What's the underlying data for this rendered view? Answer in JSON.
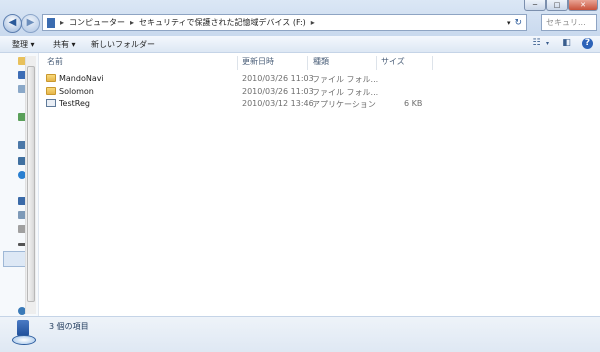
{
  "window": {
    "controls": {
      "minimize": "─",
      "maximize": "□",
      "close": "✕"
    }
  },
  "address": {
    "segments": [
      "コンピューター",
      "セキュリティで保護された記憶域デバイス (F:)"
    ],
    "separator": "▸"
  },
  "search": {
    "placeholder": "セキュリ..."
  },
  "toolbar": {
    "organize": "整理 ▾",
    "share": "共有 ▾",
    "new_folder": "新しいフォルダー"
  },
  "columns": {
    "name": "名前",
    "modified": "更新日時",
    "type": "種類",
    "size": "サイズ"
  },
  "files": [
    {
      "name": "MandoNavi",
      "modified": "2010/03/26 11:03",
      "type": "ファイル フォル...",
      "size": "",
      "icon": "folder-icon"
    },
    {
      "name": "Solomon",
      "modified": "2010/03/26 11:03",
      "type": "ファイル フォル...",
      "size": "",
      "icon": "folder-icon"
    },
    {
      "name": "TestReg",
      "modified": "2010/03/12 13:46",
      "type": "アプリケーション",
      "size": "6 KB",
      "icon": "application-icon"
    }
  ],
  "status": {
    "item_count": "3 個の項目"
  },
  "colors": {
    "titlebar": "#c9d9ee",
    "toolbar": "#dde8f4",
    "folder": "#e5b54a",
    "accent": "#2b5a9a"
  }
}
